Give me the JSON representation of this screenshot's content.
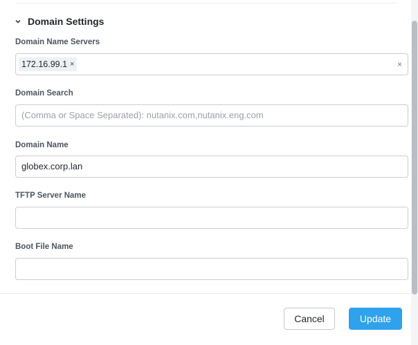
{
  "section": {
    "title": "Domain Settings",
    "chevron_icon": "chevron-down-icon"
  },
  "fields": {
    "domain_name_servers": {
      "label": "Domain Name Servers",
      "tags": [
        "172.16.99.1"
      ],
      "tag_remove_glyph": "×",
      "clear_glyph": "×"
    },
    "domain_search": {
      "label": "Domain Search",
      "value": "",
      "placeholder": "(Comma or Space Separated): nutanix.com,nutanix.eng.com"
    },
    "domain_name": {
      "label": "Domain Name",
      "value": "globex.corp.lan"
    },
    "tftp_server_name": {
      "label": "TFTP Server Name",
      "value": ""
    },
    "boot_file_name": {
      "label": "Boot File Name",
      "value": ""
    }
  },
  "footer": {
    "cancel_label": "Cancel",
    "update_label": "Update"
  },
  "colors": {
    "primary": "#2fa2ee",
    "border": "#c9ced3",
    "placeholder": "#9aa1a8"
  }
}
